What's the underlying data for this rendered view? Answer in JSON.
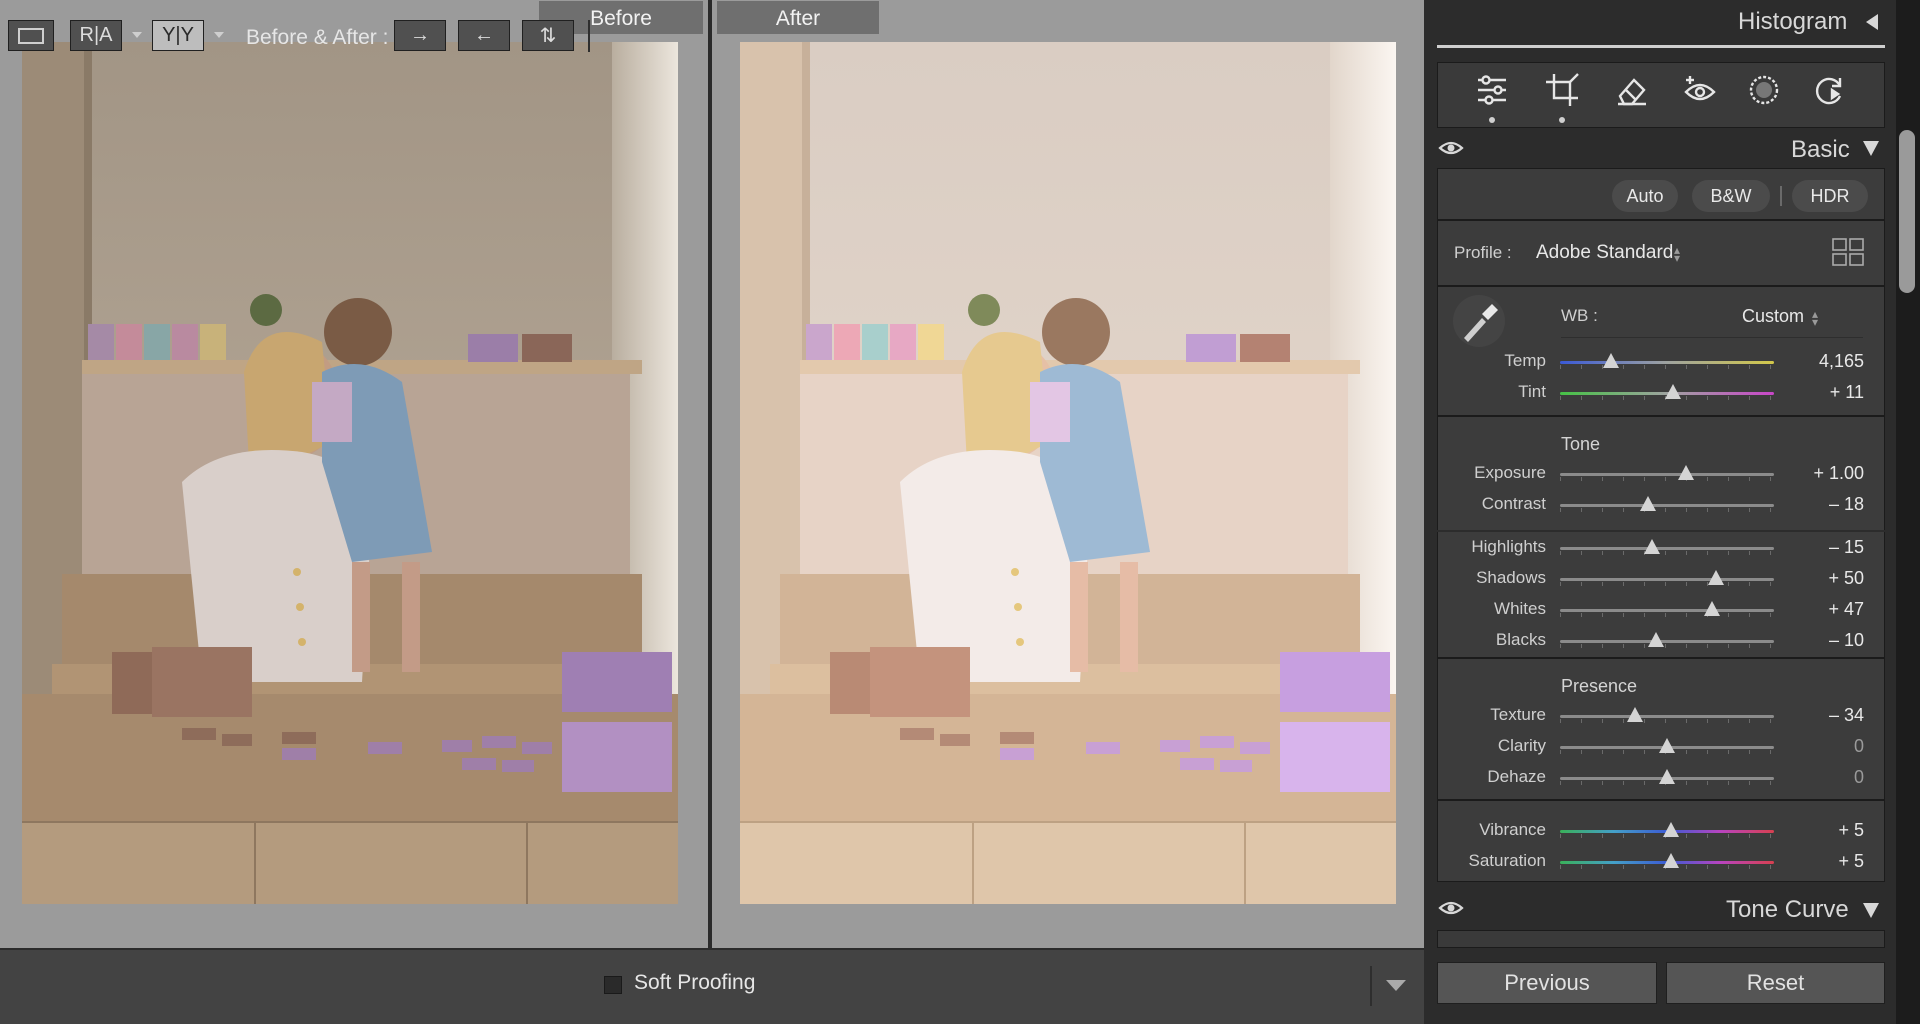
{
  "compare": {
    "before_label": "Before",
    "after_label": "After"
  },
  "toolbar": {
    "ra_label": "R|A",
    "yy_label": "Y|Y",
    "before_after_label": "Before & After :",
    "soft_proofing_label": "Soft Proofing"
  },
  "panel": {
    "histogram_title": "Histogram",
    "basic_title": "Basic",
    "tone_curve_title": "Tone Curve",
    "auto_label": "Auto",
    "bw_label": "B&W",
    "hdr_label": "HDR",
    "profile_label": "Profile :",
    "profile_value": "Adobe Standard",
    "wb_label": "WB :",
    "wb_value": "Custom",
    "tone_group": "Tone",
    "presence_group": "Presence",
    "sliders": [
      {
        "label": "Temp",
        "value": "4,165",
        "level": 0.24
      },
      {
        "label": "Tint",
        "value": "+ 11",
        "level": 0.53
      },
      {
        "label": "Exposure",
        "value": "+ 1.00",
        "level": 0.59
      },
      {
        "label": "Contrast",
        "value": "– 18",
        "level": 0.41
      },
      {
        "label": "Highlights",
        "value": "– 15",
        "level": 0.43
      },
      {
        "label": "Shadows",
        "value": "+ 50",
        "level": 0.73
      },
      {
        "label": "Whites",
        "value": "+ 47",
        "level": 0.71
      },
      {
        "label": "Blacks",
        "value": "– 10",
        "level": 0.45
      },
      {
        "label": "Texture",
        "value": "– 34",
        "level": 0.35
      },
      {
        "label": "Clarity",
        "value": "0",
        "level": 0.5
      },
      {
        "label": "Dehaze",
        "value": "0",
        "level": 0.5
      },
      {
        "label": "Vibrance",
        "value": "+ 5",
        "level": 0.52
      },
      {
        "label": "Saturation",
        "value": "+ 5",
        "level": 0.52
      }
    ],
    "previous_label": "Previous",
    "reset_label": "Reset"
  }
}
